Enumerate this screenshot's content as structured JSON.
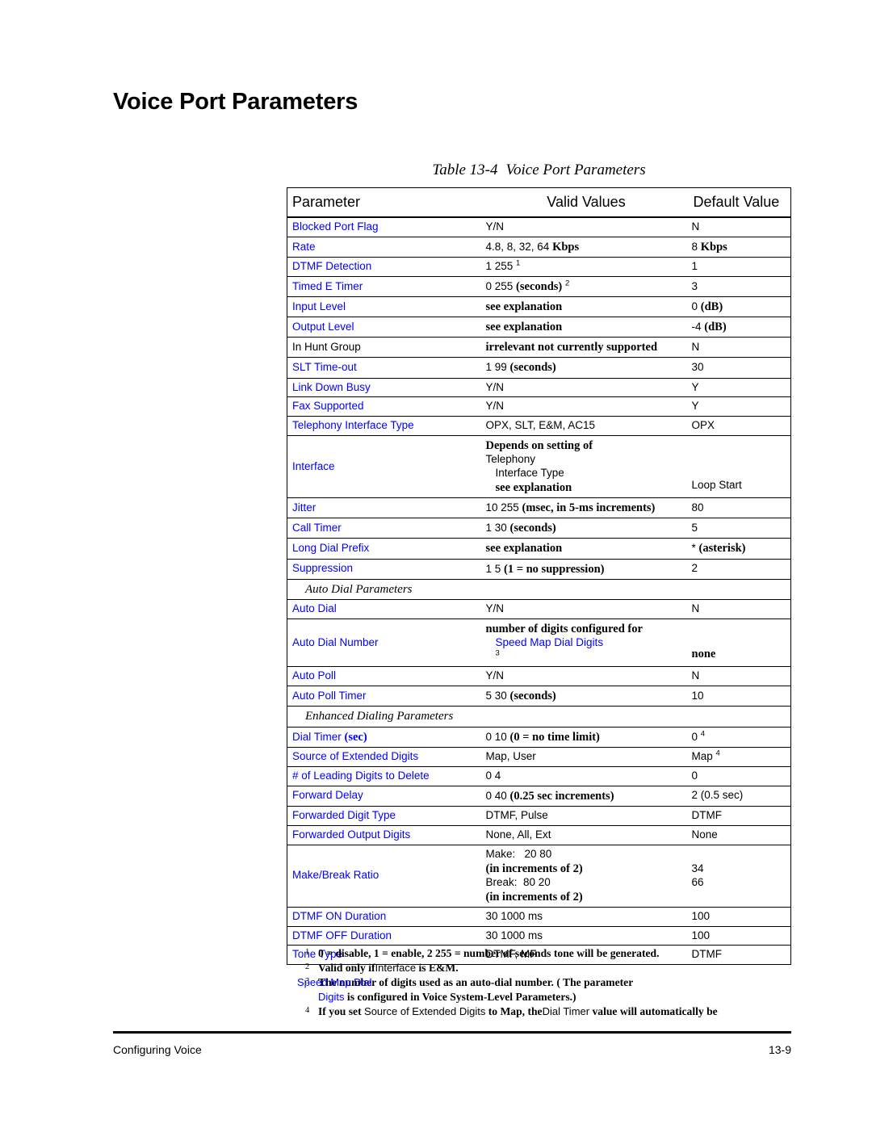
{
  "page": {
    "heading": "Voice Port Parameters",
    "caption_number": "Table 13-4",
    "caption_title": "Voice Port Parameters",
    "footer_left": "Configuring Voice",
    "footer_right": "13-9",
    "link_color": "#0000ff"
  },
  "table": {
    "columns": [
      "Parameter",
      "Valid Values",
      "Default Value"
    ],
    "rows": [
      {
        "type": "row",
        "param": "Blocked Port Flag",
        "param_link": true,
        "valid": "Y/N",
        "default": "N"
      },
      {
        "type": "row",
        "param": "Rate",
        "param_link": true,
        "valid": "4.8, 8, 32, 64 Kbps",
        "default": "8 Kbps"
      },
      {
        "type": "row",
        "param": "DTMF Detection",
        "param_link": true,
        "valid": "1 255",
        "valid_sup": "1",
        "default": "1"
      },
      {
        "type": "row",
        "param": "Timed E Timer",
        "param_link": true,
        "valid": "0 255  (seconds)",
        "valid_sup": "2",
        "default": "3"
      },
      {
        "type": "row",
        "param": "Input Level",
        "param_link": true,
        "valid": "see explanation",
        "default": "0 (dB)"
      },
      {
        "type": "row",
        "param": "Output Level",
        "param_link": true,
        "valid": "see explanation",
        "default": "-4 (dB)"
      },
      {
        "type": "row",
        "param": "In Hunt Group",
        "param_link": false,
        "valid": "irrelevant not currently supported",
        "default": "N"
      },
      {
        "type": "row",
        "param": "SLT Time-out",
        "param_link": true,
        "valid": "1 99 (seconds)",
        "default": "30"
      },
      {
        "type": "row",
        "param": "Link Down Busy",
        "param_link": true,
        "valid": "Y/N",
        "default": "Y"
      },
      {
        "type": "row",
        "param": "Fax Supported",
        "param_link": true,
        "valid": "Y/N",
        "default": "Y"
      },
      {
        "type": "row",
        "param": "Telephony Interface Type",
        "param_link": true,
        "valid": "OPX, SLT, E&M, AC15",
        "default": "OPX"
      },
      {
        "type": "row2",
        "param": "Interface",
        "param_link": true,
        "valid_line1": "Depends on setting of Telephony",
        "valid_line2": "Interface Type  see explanation",
        "default": "Loop Start"
      },
      {
        "type": "row",
        "param": "Jitter",
        "param_link": true,
        "valid": "10 255  (msec, in 5-ms increments)",
        "default": "80"
      },
      {
        "type": "row",
        "param": "Call Timer",
        "param_link": true,
        "valid": "1 30 (seconds)",
        "default": "5"
      },
      {
        "type": "row",
        "param": "Long Dial Prefix",
        "param_link": true,
        "valid": "see explanation",
        "default": "* (asterisk)"
      },
      {
        "type": "row",
        "param": "Suppression",
        "param_link": true,
        "valid": "1 5  (1 = no suppression)",
        "default": "2"
      },
      {
        "type": "section",
        "label": "Auto Dial Parameters"
      },
      {
        "type": "row",
        "param": "Auto Dial",
        "param_link": true,
        "valid": "Y/N",
        "default": "N"
      },
      {
        "type": "row2",
        "param": "Auto Dial Number",
        "param_link": true,
        "valid_line1": "number of digits configured for",
        "valid_line2": "Speed Map Dial Digits",
        "valid_line2_link": true,
        "valid_sup": "3",
        "default": "none"
      },
      {
        "type": "row",
        "param": "Auto Poll",
        "param_link": true,
        "valid": "Y/N",
        "default": "N"
      },
      {
        "type": "row",
        "param": "Auto Poll Timer",
        "param_link": true,
        "valid": "5 30 (seconds)",
        "default": "10"
      },
      {
        "type": "section",
        "label": "Enhanced Dialing Parameters"
      },
      {
        "type": "row",
        "param": "Dial Timer (sec)",
        "param_link": true,
        "valid": "0 10 (0 = no time limit)",
        "default": "0",
        "default_sup": "4"
      },
      {
        "type": "row",
        "param": "Source of Extended Digits",
        "param_link": true,
        "valid": "Map, User",
        "default": "Map",
        "default_sup": "4"
      },
      {
        "type": "row",
        "param": "# of Leading Digits to Delete",
        "param_link": true,
        "valid": "0 4",
        "default": "0"
      },
      {
        "type": "row",
        "param": "Forward Delay",
        "param_link": true,
        "valid": "0 40 (0.25 sec increments)",
        "default": "2 (0.5 sec)"
      },
      {
        "type": "row",
        "param": "Forwarded Digit Type",
        "param_link": true,
        "valid": "DTMF, Pulse",
        "default": "DTMF"
      },
      {
        "type": "row",
        "param": "Forwarded Output Digits",
        "param_link": true,
        "valid": "None, All, Ext",
        "default": "None"
      },
      {
        "type": "makebreak",
        "param": "Make/Break Ratio",
        "param_link": true,
        "line1_label": "Make:",
        "line1_range": "20 80",
        "line1_note": "(in increments of 2)",
        "line1_default": "34",
        "line2_label": "Break:",
        "line2_range": "80 20",
        "line2_note": "(in increments of 2)",
        "line2_default": "66"
      },
      {
        "type": "row",
        "param": "DTMF ON Duration",
        "param_link": true,
        "valid": "30 1000 ms",
        "default": "100"
      },
      {
        "type": "row",
        "param": "DTMF OFF Duration",
        "param_link": true,
        "valid": "30 1000 ms",
        "default": "100"
      },
      {
        "type": "row",
        "param": "Tone Type",
        "param_link": true,
        "valid": "DTMF, MF",
        "default": "DTMF"
      }
    ]
  },
  "footnotes": [
    {
      "num": "1",
      "text": "0 = disable, 1 = enable, 2 255  = number of seconds tone will be generated."
    },
    {
      "num": "2",
      "pre": "Valid only if",
      "link": "Interface",
      "post": " is E&M."
    },
    {
      "num": "3",
      "line1_pre": "The number of digits used as an auto-dial number. ( The parameter",
      "overlap_link": "Speed Map Dial",
      "line2_link": "Digits",
      "line2_post": " is configured in Voice System-Level Parameters.)"
    },
    {
      "num": "4",
      "pre": "If you set ",
      "link1": "Source of Extended Digits",
      "mid": " to Map, the",
      "link2": "Dial Timer",
      "post": " value will automatically be"
    }
  ]
}
